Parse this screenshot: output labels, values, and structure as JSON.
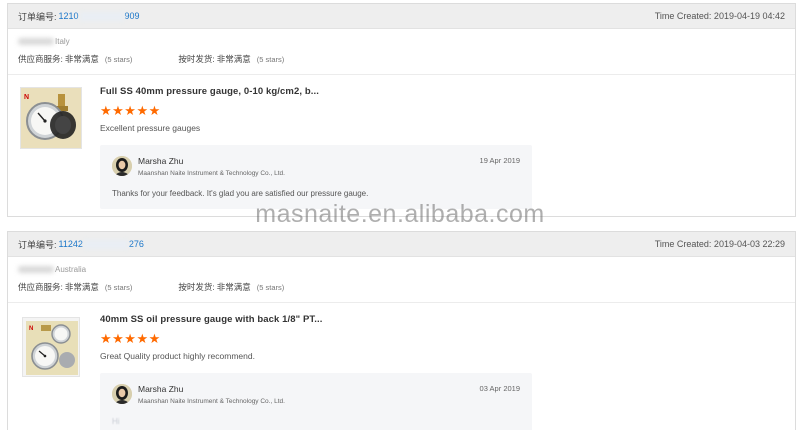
{
  "orders": [
    {
      "order_label": "订单编号:",
      "order_no_start": "1210",
      "order_no_end": "909",
      "time_created": "Time Created: 2019-04-19 04:42",
      "buyer_country": "Italy",
      "supplier_service_label": "供应商服务:",
      "supplier_service_value": "非常满意",
      "supplier_service_stars": "(5 stars)",
      "ontime_label": "按时发货:",
      "ontime_value": "非常满意",
      "ontime_stars": "(5 stars)",
      "product_title": "Full SS 40mm pressure gauge, 0-10 kg/cm2, b...",
      "rating_stars": "★★★★★",
      "rating": 5,
      "comment": "Excellent pressure gauges",
      "reply": {
        "name": "Marsha Zhu",
        "company": "Maanshan Naite Instrument & Technology Co., Ltd.",
        "date": "19 Apr 2019",
        "text": "Thanks for your feedback. It's glad you are satisfied our pressure gauge."
      }
    },
    {
      "order_label": "订单编号:",
      "order_no_start": "11242",
      "order_no_end": "276",
      "time_created": "Time Created: 2019-04-03 22:29",
      "buyer_country": "Australia",
      "supplier_service_label": "供应商服务:",
      "supplier_service_value": "非常满意",
      "supplier_service_stars": "(5 stars)",
      "ontime_label": "按时发货:",
      "ontime_value": "非常满意",
      "ontime_stars": "(5 stars)",
      "product_title": "40mm SS oil pressure gauge with back 1/8\" PT...",
      "rating_stars": "★★★★★",
      "rating": 5,
      "comment": "Great Quality product highly recommend.",
      "reply": {
        "name": "Marsha Zhu",
        "company": "Maanshan Naite Instrument & Technology Co., Ltd.",
        "date": "03 Apr 2019",
        "text": "Hi"
      }
    }
  ],
  "watermark": "masnaite.en.alibaba.com",
  "colors": {
    "order_link": "#1a76c9",
    "star": "#ff6a00",
    "header_bg": "#eeeeee",
    "reply_bg": "#f5f6f8"
  }
}
